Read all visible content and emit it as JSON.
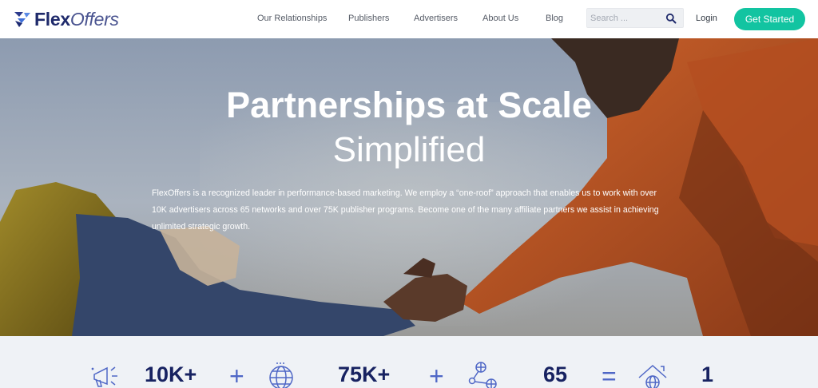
{
  "brand": {
    "name_bold": "Flex",
    "name_rest": "Offers"
  },
  "nav": {
    "items": [
      {
        "label": "Our Relationships"
      },
      {
        "label": "Publishers"
      },
      {
        "label": "Advertisers"
      },
      {
        "label": "About Us"
      },
      {
        "label": "Blog"
      }
    ],
    "search": {
      "placeholder": "Search ...",
      "value": ""
    },
    "login_label": "Login",
    "cta_label": "Get Started"
  },
  "hero": {
    "title": "Partnerships at Scale",
    "subtitle": "Simplified",
    "body": "FlexOffers is a recognized leader in performance-based marketing. We employ a “one-roof” approach that enables us to work with over 10K advertisers across 65 networks and over 75K publisher programs. Become one of the many affiliate partners we assist in achieving unlimited strategic growth."
  },
  "stats": {
    "items": [
      {
        "value": "10K+",
        "icon": "megaphone-icon"
      },
      {
        "value": "75K+",
        "icon": "globe-icon"
      },
      {
        "value": "65",
        "icon": "network-icon"
      },
      {
        "value": "1",
        "icon": "house-globe-icon"
      }
    ],
    "operators": [
      "+",
      "+",
      "="
    ],
    "colors": {
      "value": "#172261",
      "operator": "#4f67c6"
    }
  },
  "colors": {
    "brand": "#1f2a6b",
    "accent": "#12c4a1",
    "nav_text": "#555b66"
  }
}
